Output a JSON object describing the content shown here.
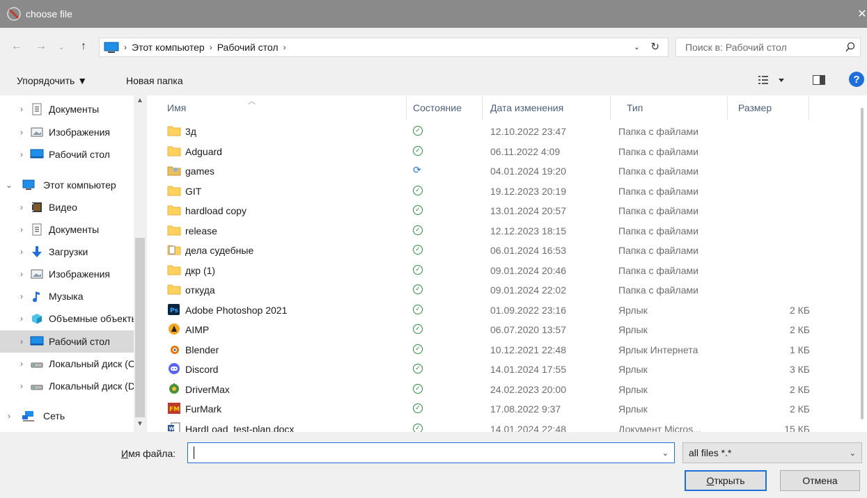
{
  "window": {
    "title": "choose file",
    "close_glyph": "✕"
  },
  "address": {
    "crumbs": [
      "Этот компьютер",
      "Рабочий стол"
    ],
    "search_placeholder": "Поиск в: Рабочий стол"
  },
  "toolbar": {
    "organize_label": "Упорядочить ▼",
    "new_folder_label": "Новая папка",
    "help_label": "?"
  },
  "nav": {
    "items": [
      {
        "label": "Документы",
        "icon": "documents-icon",
        "chev": "›",
        "level": 1
      },
      {
        "label": "Изображения",
        "icon": "pictures-icon",
        "chev": "›",
        "level": 1
      },
      {
        "label": "Рабочий стол",
        "icon": "desktop-icon",
        "chev": "›",
        "level": 1
      },
      {
        "label": "Этот компьютер",
        "icon": "computer-icon",
        "chev": "⌄",
        "level": 0
      },
      {
        "label": "Видео",
        "icon": "video-icon",
        "chev": "›",
        "level": 1
      },
      {
        "label": "Документы",
        "icon": "documents-icon",
        "chev": "›",
        "level": 1
      },
      {
        "label": "Загрузки",
        "icon": "downloads-icon",
        "chev": "›",
        "level": 1
      },
      {
        "label": "Изображения",
        "icon": "pictures-icon",
        "chev": "›",
        "level": 1
      },
      {
        "label": "Музыка",
        "icon": "music-icon",
        "chev": "›",
        "level": 1
      },
      {
        "label": "Объемные объекты",
        "icon": "3d-objects-icon",
        "chev": "›",
        "level": 1
      },
      {
        "label": "Рабочий стол",
        "icon": "desktop-icon",
        "chev": "›",
        "level": 1,
        "selected": true
      },
      {
        "label": "Локальный диск (C:)",
        "icon": "local-disk-icon",
        "chev": "›",
        "level": 1
      },
      {
        "label": "Локальный диск (D:)",
        "icon": "local-disk-icon",
        "chev": "›",
        "level": 1
      },
      {
        "label": "Сеть",
        "icon": "network-icon",
        "chev": "›",
        "level": 0
      }
    ]
  },
  "columns": {
    "name": "Имя",
    "status": "Состояние",
    "modified": "Дата изменения",
    "type": "Тип",
    "size": "Размер"
  },
  "files": [
    {
      "name": "3д",
      "icon": "folder-icon",
      "status": "ok",
      "modified": "12.10.2022 23:47",
      "type": "Папка с файлами",
      "size": ""
    },
    {
      "name": "Adguard",
      "icon": "folder-icon",
      "status": "ok",
      "modified": "06.11.2022 4:09",
      "type": "Папка с файлами",
      "size": ""
    },
    {
      "name": "games",
      "icon": "folder-games-icon",
      "status": "sync",
      "modified": "04.01.2024 19:20",
      "type": "Папка с файлами",
      "size": ""
    },
    {
      "name": "GIT",
      "icon": "folder-icon",
      "status": "ok",
      "modified": "19.12.2023 20:19",
      "type": "Папка с файлами",
      "size": ""
    },
    {
      "name": "hardload copy",
      "icon": "folder-icon",
      "status": "ok",
      "modified": "13.01.2024 20:57",
      "type": "Папка с файлами",
      "size": ""
    },
    {
      "name": "release",
      "icon": "folder-icon",
      "status": "ok",
      "modified": "12.12.2023 18:15",
      "type": "Папка с файлами",
      "size": ""
    },
    {
      "name": "дела судебные",
      "icon": "folder-docs-icon",
      "status": "ok",
      "modified": "06.01.2024 16:53",
      "type": "Папка с файлами",
      "size": ""
    },
    {
      "name": "дкр (1)",
      "icon": "folder-icon",
      "status": "ok",
      "modified": "09.01.2024 20:46",
      "type": "Папка с файлами",
      "size": ""
    },
    {
      "name": "откуда",
      "icon": "folder-icon",
      "status": "ok",
      "modified": "09.01.2024 22:02",
      "type": "Папка с файлами",
      "size": ""
    },
    {
      "name": "Adobe Photoshop 2021",
      "icon": "photoshop-icon",
      "status": "ok",
      "modified": "01.09.2022 23:16",
      "type": "Ярлык",
      "size": "2 КБ"
    },
    {
      "name": "AIMP",
      "icon": "aimp-icon",
      "status": "ok",
      "modified": "06.07.2020 13:57",
      "type": "Ярлык",
      "size": "2 КБ"
    },
    {
      "name": "Blender",
      "icon": "blender-icon",
      "status": "ok",
      "modified": "10.12.2021 22:48",
      "type": "Ярлык Интернета",
      "size": "1 КБ"
    },
    {
      "name": "Discord",
      "icon": "discord-icon",
      "status": "ok",
      "modified": "14.01.2024 17:55",
      "type": "Ярлык",
      "size": "3 КБ"
    },
    {
      "name": "DriverMax",
      "icon": "drivermax-icon",
      "status": "ok",
      "modified": "24.02.2023 20:00",
      "type": "Ярлык",
      "size": "2 КБ"
    },
    {
      "name": "FurMark",
      "icon": "furmark-icon",
      "status": "ok",
      "modified": "17.08.2022 9:37",
      "type": "Ярлык",
      "size": "2 КБ"
    },
    {
      "name": "HardLoad_test-plan.docx",
      "icon": "word-document-icon",
      "status": "ok",
      "modified": "14.01.2024 22:48",
      "type": "Документ Micros...",
      "size": "15 КБ"
    }
  ],
  "bottom": {
    "filename_label_u": "И",
    "filename_label_rest": "мя файла:",
    "filename_value": "",
    "filter_value": "all files *.*",
    "open_label_u": "О",
    "open_label_rest": "ткрыть",
    "cancel_label": "Отмена"
  },
  "colors": {
    "accent": "#1e6fd9",
    "status_ok": "#2e8b3f",
    "folder": "#ffd25e"
  }
}
